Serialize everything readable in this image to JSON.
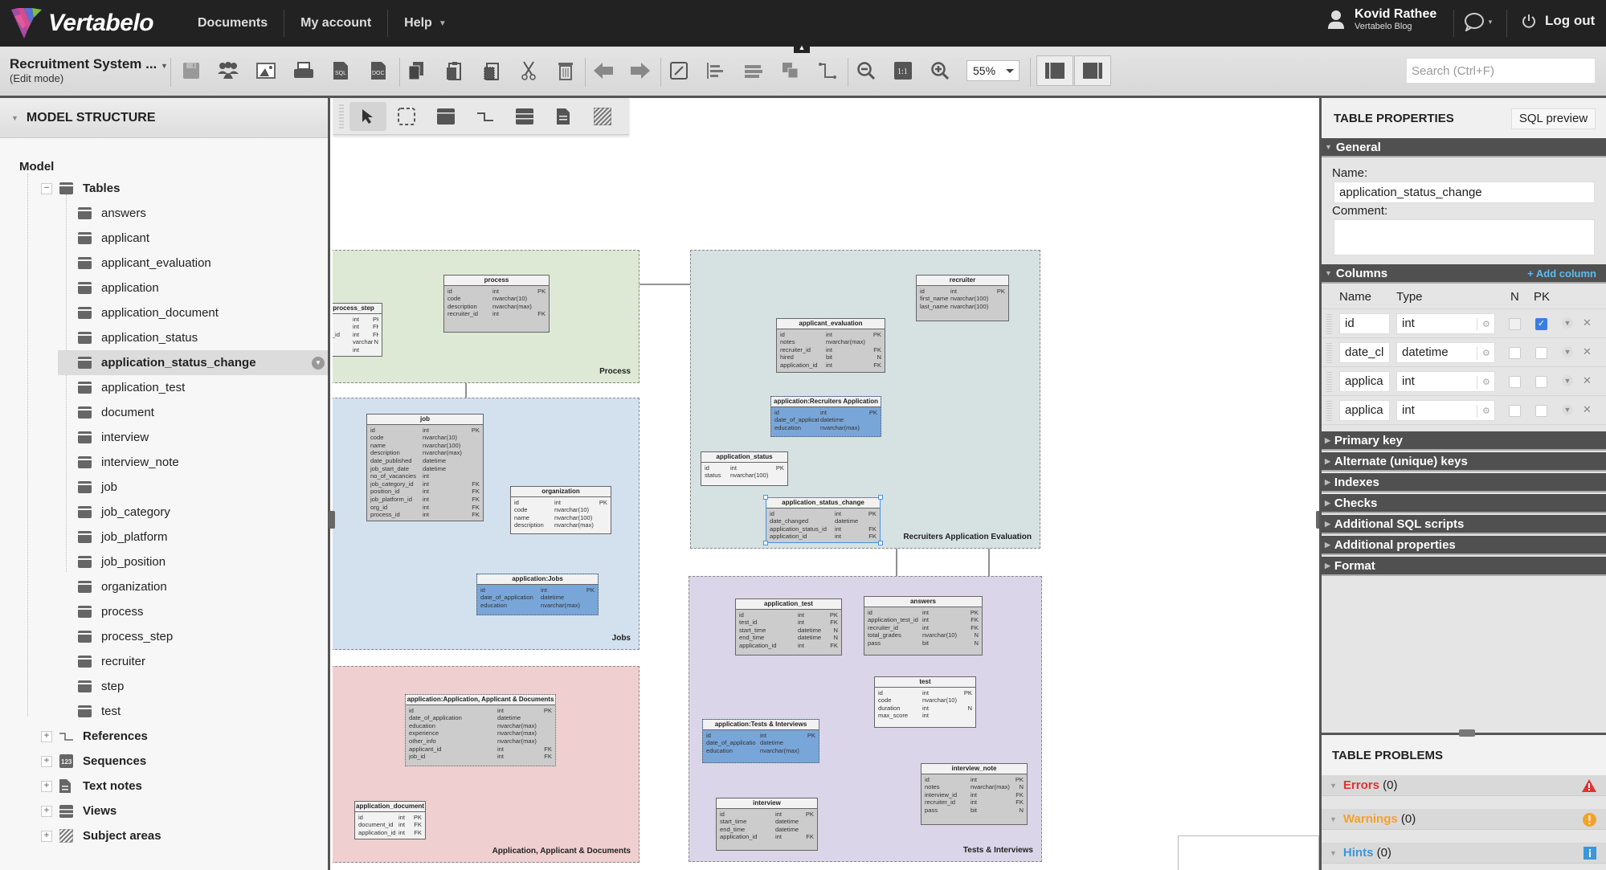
{
  "topbar": {
    "brand": "Vertabelo",
    "nav": [
      "Documents",
      "My account",
      "Help"
    ],
    "user_name": "Kovid Rathee",
    "user_sub": "Vertabelo Blog",
    "logout": "Log out"
  },
  "toolbar": {
    "doc_title": "Recruitment System ...",
    "doc_mode": "(Edit mode)",
    "zoom_level": "55%",
    "search_placeholder": "Search (Ctrl+F)"
  },
  "left_panel": {
    "title": "MODEL STRUCTURE",
    "root": "Model",
    "tables_label": "Tables",
    "tables": [
      "answers",
      "applicant",
      "applicant_evaluation",
      "application",
      "application_document",
      "application_status",
      "application_status_change",
      "application_test",
      "document",
      "interview",
      "interview_note",
      "job",
      "job_category",
      "job_platform",
      "job_position",
      "organization",
      "process",
      "process_step",
      "recruiter",
      "step",
      "test"
    ],
    "selected_table": "application_status_change",
    "groups": [
      "References",
      "Sequences",
      "Text notes",
      "Views",
      "Subject areas"
    ]
  },
  "diagram": {
    "areas": [
      {
        "name": "Process",
        "color": "#dde8d5"
      },
      {
        "name": "Jobs",
        "color": "#d3e1ef"
      },
      {
        "name": "Application, Applicant & Documents",
        "color": "#efcfcf"
      },
      {
        "name": "Recruiters Application Evaluation",
        "color": "#d6e1e2"
      },
      {
        "name": "Tests & Interviews",
        "color": "#dad5e8"
      }
    ],
    "tables": {
      "process_step": {
        "title": "process_step",
        "rows": [
          [
            "",
            "int",
            "PK"
          ],
          [
            "",
            "int",
            "FK"
          ],
          [
            "s_id",
            "int",
            "FK"
          ],
          [
            "",
            "varchar",
            "N"
          ],
          [
            "",
            "int",
            ""
          ]
        ]
      },
      "process": {
        "title": "process",
        "rows": [
          [
            "id",
            "int",
            "PK"
          ],
          [
            "code",
            "nvarchar(10)",
            ""
          ],
          [
            "description",
            "nvarchar(max)",
            ""
          ],
          [
            "recruiter_id",
            "int",
            "FK"
          ]
        ]
      },
      "job": {
        "title": "job",
        "rows": [
          [
            "id",
            "int",
            "PK"
          ],
          [
            "code",
            "nvarchar(10)",
            ""
          ],
          [
            "name",
            "nvarchar(100)",
            ""
          ],
          [
            "description",
            "nvarchar(max)",
            ""
          ],
          [
            "date_published",
            "datetime",
            ""
          ],
          [
            "job_start_date",
            "datetime",
            ""
          ],
          [
            "no_of_vacancies",
            "int",
            ""
          ],
          [
            "job_category_id",
            "int",
            "FK"
          ],
          [
            "position_id",
            "int",
            "FK"
          ],
          [
            "job_platform_id",
            "int",
            "FK"
          ],
          [
            "org_id",
            "int",
            "FK"
          ],
          [
            "process_id",
            "int",
            "FK"
          ]
        ]
      },
      "organization": {
        "title": "organization",
        "rows": [
          [
            "id",
            "int",
            "PK"
          ],
          [
            "code",
            "nvarchar(10)",
            ""
          ],
          [
            "name",
            "nvarchar(100)",
            ""
          ],
          [
            "description",
            "nvarchar(max)",
            ""
          ]
        ]
      },
      "app_jobs": {
        "title": "application:Jobs",
        "rows": [
          [
            "id",
            "int",
            "PK"
          ],
          [
            "date_of_application",
            "datetime",
            ""
          ],
          [
            "education",
            "nvarchar(max)",
            ""
          ]
        ]
      },
      "app_docs": {
        "title": "application:Application, Applicant & Documents",
        "rows": [
          [
            "id",
            "int",
            "PK"
          ],
          [
            "date_of_application",
            "datetime",
            ""
          ],
          [
            "education",
            "nvarchar(max)",
            ""
          ],
          [
            "experience",
            "nvarchar(max)",
            ""
          ],
          [
            "other_info",
            "nvarchar(max)",
            ""
          ],
          [
            "applicant_id",
            "int",
            "FK"
          ],
          [
            "job_id",
            "int",
            "FK"
          ]
        ]
      },
      "application_document": {
        "title": "application_document",
        "rows": [
          [
            "id",
            "int",
            "PK"
          ],
          [
            "document_id",
            "int",
            "FK"
          ],
          [
            "application_id",
            "int",
            "FK"
          ]
        ]
      },
      "recruiter": {
        "title": "recruiter",
        "rows": [
          [
            "id",
            "int",
            "PK"
          ],
          [
            "first_name",
            "nvarchar(100)",
            ""
          ],
          [
            "last_name",
            "nvarchar(100)",
            ""
          ]
        ]
      },
      "applicant_evaluation": {
        "title": "applicant_evaluation",
        "rows": [
          [
            "id",
            "int",
            "PK"
          ],
          [
            "notes",
            "nvarchar(max)",
            ""
          ],
          [
            "recruiter_id",
            "int",
            "FK"
          ],
          [
            "hired",
            "bit",
            "N"
          ],
          [
            "application_id",
            "int",
            "FK"
          ]
        ]
      },
      "app_recruiters": {
        "title": "application:Recruiters Application",
        "rows": [
          [
            "id",
            "int",
            "PK"
          ],
          [
            "date_of_applicat",
            "datetime",
            ""
          ],
          [
            "education",
            "nvarchar(max)",
            ""
          ]
        ]
      },
      "application_status": {
        "title": "application_status",
        "rows": [
          [
            "id",
            "int",
            "PK"
          ],
          [
            "status",
            "nvarchar(100)",
            ""
          ]
        ]
      },
      "application_status_change": {
        "title": "application_status_change",
        "rows": [
          [
            "id",
            "int",
            "PK"
          ],
          [
            "date_changed",
            "datetime",
            ""
          ],
          [
            "application_status_id",
            "int",
            "FK"
          ],
          [
            "application_id",
            "int",
            "FK"
          ]
        ]
      },
      "application_test": {
        "title": "application_test",
        "rows": [
          [
            "id",
            "int",
            "PK"
          ],
          [
            "test_id",
            "int",
            "FK"
          ],
          [
            "start_time",
            "datetime",
            "N"
          ],
          [
            "end_time",
            "datetime",
            "N"
          ],
          [
            "application_id",
            "int",
            "FK"
          ]
        ]
      },
      "answers": {
        "title": "answers",
        "rows": [
          [
            "id",
            "int",
            "PK"
          ],
          [
            "application_test_id",
            "int",
            "FK"
          ],
          [
            "recruiter_id",
            "int",
            "FK"
          ],
          [
            "total_grades",
            "nvarchar(10)",
            "N"
          ],
          [
            "pass",
            "bit",
            "N"
          ]
        ]
      },
      "test": {
        "title": "test",
        "rows": [
          [
            "id",
            "int",
            "PK"
          ],
          [
            "code",
            "nvarchar(10)",
            ""
          ],
          [
            "duration",
            "int",
            "N"
          ],
          [
            "max_score",
            "int",
            ""
          ]
        ]
      },
      "app_tests": {
        "title": "application:Tests & Interviews",
        "rows": [
          [
            "id",
            "int",
            "PK"
          ],
          [
            "date_of_applicatio",
            "datetime",
            ""
          ],
          [
            "education",
            "nvarchar(max)",
            ""
          ]
        ]
      },
      "interview": {
        "title": "interview",
        "rows": [
          [
            "id",
            "int",
            "PK"
          ],
          [
            "start_time",
            "datetime",
            ""
          ],
          [
            "end_time",
            "datetime",
            ""
          ],
          [
            "application_id",
            "int",
            "FK"
          ]
        ]
      },
      "interview_note": {
        "title": "interview_note",
        "rows": [
          [
            "id",
            "int",
            "PK"
          ],
          [
            "notes",
            "nvarchar(max)",
            "N"
          ],
          [
            "interview_id",
            "int",
            "FK"
          ],
          [
            "recruiter_id",
            "int",
            "FK"
          ],
          [
            "pass",
            "bit",
            "N"
          ]
        ]
      }
    }
  },
  "right_panel": {
    "title": "TABLE PROPERTIES",
    "sql_preview": "SQL preview",
    "general": "General",
    "name_label": "Name:",
    "name_value": "application_status_change",
    "comment_label": "Comment:",
    "comment_value": "",
    "columns": "Columns",
    "add_column": "+ Add column",
    "col_headers": {
      "name": "Name",
      "type": "Type",
      "n": "N",
      "pk": "PK"
    },
    "column_rows": [
      {
        "name": "id",
        "type": "int",
        "n": false,
        "pk": true,
        "n_disabled": true
      },
      {
        "name": "date_cl",
        "type": "datetime",
        "n": false,
        "pk": false
      },
      {
        "name": "applica",
        "type": "int",
        "n": false,
        "pk": false
      },
      {
        "name": "applica",
        "type": "int",
        "n": false,
        "pk": false
      }
    ],
    "sections": [
      "Primary key",
      "Alternate (unique) keys",
      "Indexes",
      "Checks",
      "Additional SQL scripts",
      "Additional properties",
      "Format"
    ],
    "problems_title": "TABLE PROBLEMS",
    "errors": {
      "label": "Errors",
      "count": "(0)",
      "color": "#e23232"
    },
    "warnings": {
      "label": "Warnings",
      "count": "(0)",
      "color": "#f2a22a"
    },
    "hints": {
      "label": "Hints",
      "count": "(0)",
      "color": "#3a96dd"
    }
  }
}
